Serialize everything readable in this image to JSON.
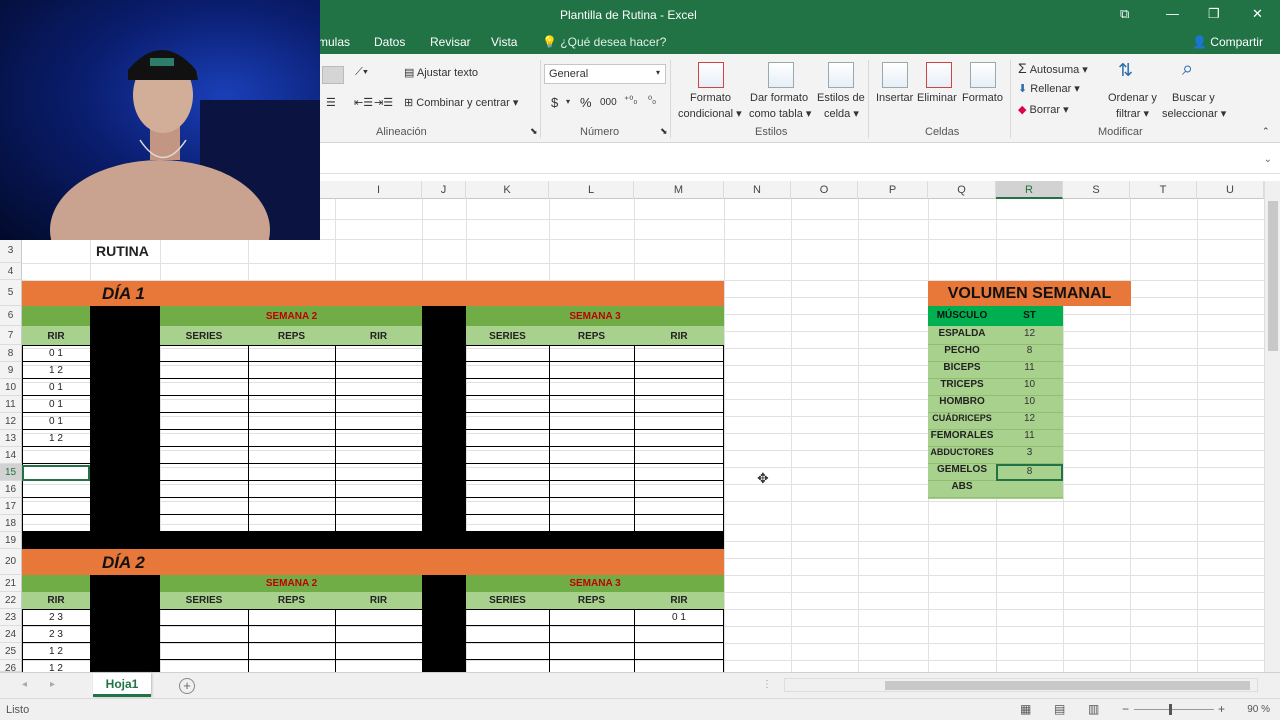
{
  "app": {
    "title": "Plantilla de Rutina - Excel"
  },
  "window_controls": {
    "restore_box": "⧉",
    "minimize": "—",
    "maximize": "❐",
    "close": "✕"
  },
  "tabs": [
    "mulas",
    "Datos",
    "Revisar",
    "Vista"
  ],
  "tell_me": "¿Qué desea hacer?",
  "share": "Compartir",
  "ribbon": {
    "alignment": {
      "wrap": "Ajustar texto",
      "merge": "Combinar y centrar",
      "label": "Alineación"
    },
    "number": {
      "format": "General",
      "currency": "$",
      "percent": "%",
      "thousands": "000",
      "label": "Número"
    },
    "styles": {
      "conditional": [
        "Formato",
        "condicional"
      ],
      "table": [
        "Dar formato",
        "como tabla"
      ],
      "cell": [
        "Estilos de",
        "celda"
      ],
      "label": "Estilos"
    },
    "cells": {
      "insert": "Insertar",
      "delete": "Eliminar",
      "format": "Formato",
      "label": "Celdas"
    },
    "editing": {
      "autosum": "Autosuma",
      "fill": "Rellenar",
      "clear": "Borrar",
      "sort": [
        "Ordenar y",
        "filtrar"
      ],
      "find": [
        "Buscar y",
        "seleccionar"
      ],
      "label": "Modificar"
    }
  },
  "columns": [
    "I",
    "J",
    "K",
    "L",
    "M",
    "N",
    "O",
    "P",
    "Q",
    "R",
    "S",
    "T",
    "U"
  ],
  "rows": [
    "3",
    "4",
    "5",
    "6",
    "7",
    "8",
    "9",
    "10",
    "11",
    "12",
    "13",
    "14",
    "15",
    "16",
    "17",
    "18",
    "19",
    "20",
    "21",
    "22",
    "23",
    "24",
    "25",
    "26"
  ],
  "sheet": {
    "title": "RUTINA",
    "day1": "DÍA 1",
    "day2": "DÍA 2",
    "semana2": "SEMANA 2",
    "semana3": "SEMANA 3",
    "series": "SERIES",
    "reps": "REPS",
    "rir": "RIR",
    "day1_rir": [
      "0 1",
      "1 2",
      "0 1",
      "0 1",
      "0 1",
      "1 2"
    ],
    "day2_rir": [
      "2 3",
      "2 3",
      "1 2",
      "1 2"
    ],
    "day2_m23": "0 1"
  },
  "volumen": {
    "title": "VOLUMEN SEMANAL",
    "col_musculo": "MÚSCULO",
    "col_st": "ST",
    "rows": [
      {
        "musculo": "ESPALDA",
        "st": "12"
      },
      {
        "musculo": "PECHO",
        "st": "8"
      },
      {
        "musculo": "BÍCEPS",
        "st": "11"
      },
      {
        "musculo": "TRÍCEPS",
        "st": "10"
      },
      {
        "musculo": "HOMBRO",
        "st": "10"
      },
      {
        "musculo": "CUÁDRICEPS",
        "st": "12"
      },
      {
        "musculo": "FEMORALES",
        "st": "11"
      },
      {
        "musculo": "ABDUCTORES",
        "st": "3"
      },
      {
        "musculo": "GEMELOS",
        "st": "8"
      },
      {
        "musculo": "ABS",
        "st": ""
      }
    ]
  },
  "sheet_tab": "Hoja1",
  "add_sheet": "+",
  "status": {
    "ready": "Listo",
    "zoom": "90 %"
  },
  "colors": {
    "excel_green": "#217346",
    "orange": "#e8773a",
    "green": "#70ad47",
    "light_green": "#a9d18e"
  }
}
